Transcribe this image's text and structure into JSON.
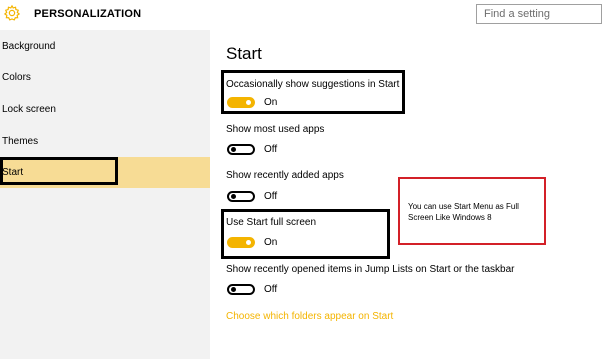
{
  "header": {
    "title": "PERSONALIZATION",
    "icon": "gear-icon",
    "search_placeholder": "Find a setting"
  },
  "sidebar": {
    "items": [
      {
        "label": "Background"
      },
      {
        "label": "Colors"
      },
      {
        "label": "Lock screen"
      },
      {
        "label": "Themes"
      },
      {
        "label": "Start",
        "selected": true
      }
    ]
  },
  "main": {
    "heading": "Start",
    "settings": [
      {
        "label": "Occasionally show suggestions in Start",
        "state": "On",
        "enabled": true
      },
      {
        "label": "Show most used apps",
        "state": "Off",
        "enabled": false
      },
      {
        "label": "Show recently added apps",
        "state": "Off",
        "enabled": false
      },
      {
        "label": "Use Start full screen",
        "state": "On",
        "enabled": true
      },
      {
        "label": "Show recently opened items in Jump Lists on Start or the taskbar",
        "state": "Off",
        "enabled": false
      }
    ],
    "link": "Choose which folders appear on Start"
  },
  "annotation": {
    "note": "You can use Start Menu as Full Screen Like Windows 8"
  },
  "colors": {
    "accent": "#f4b400",
    "selected_bg": "#f7dc95",
    "sidebar_bg": "#f2f2f2",
    "annotation_red": "#d32028"
  }
}
